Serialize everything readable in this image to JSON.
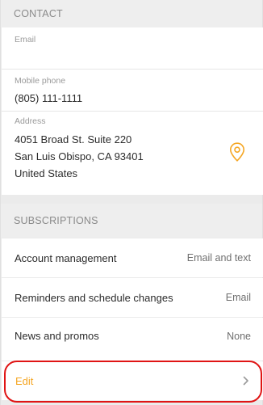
{
  "contact": {
    "header": "CONTACT",
    "email": {
      "label": "Email",
      "value": ""
    },
    "mobile": {
      "label": "Mobile phone",
      "value": "(805) 111-1111"
    },
    "address": {
      "label": "Address",
      "line1": "4051 Broad St. Suite 220",
      "line2": "San Luis Obispo, CA 93401",
      "line3": "United States",
      "icon": "map-pin-icon"
    }
  },
  "subscriptions": {
    "header": "SUBSCRIPTIONS",
    "items": [
      {
        "label": "Account management",
        "value": "Email and text"
      },
      {
        "label": "Reminders and schedule changes",
        "value": "Email"
      },
      {
        "label": "News and promos",
        "value": "None"
      }
    ],
    "edit_label": "Edit"
  },
  "colors": {
    "accent": "#f5a623",
    "highlight": "#e01414"
  }
}
